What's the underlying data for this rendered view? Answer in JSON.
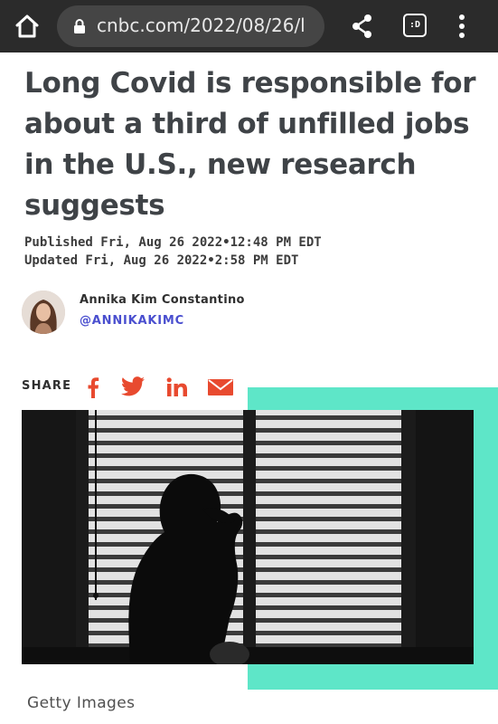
{
  "browser": {
    "url": "cnbc.com/2022/08/26/l",
    "extension_label": ":D",
    "icons": {
      "home": "home-icon",
      "lock": "lock-icon",
      "share": "share-icon",
      "extension": "extension-icon",
      "menu": "more-vert-icon"
    }
  },
  "article": {
    "headline": "Long Covid is responsible for about a third of unfilled jobs in the U.S., new research suggests",
    "published": "Published Fri, Aug 26 2022•12:48 PM EDT",
    "updated": "Updated Fri, Aug 26 2022•2:58 PM EDT",
    "author": {
      "name": "Annika Kim Constantino",
      "handle": "@ANNIKAKIMC"
    },
    "share": {
      "label": "SHARE",
      "icons": [
        "facebook-icon",
        "twitter-icon",
        "linkedin-icon",
        "email-icon"
      ]
    },
    "image_caption": "Getty Images"
  },
  "colors": {
    "browser_bar": "#2b2b2b",
    "url_box": "#454545",
    "headline": "#3f4347",
    "author_handle": "#4a4fcf",
    "share_icons": "#e84a2f",
    "teal_accent": "#5ee6c8"
  }
}
